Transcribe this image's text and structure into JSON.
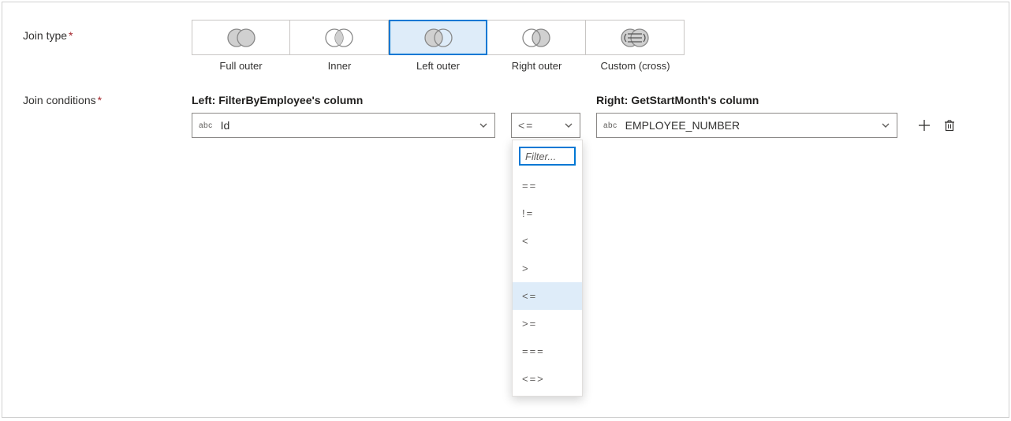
{
  "joinType": {
    "label": "Join type",
    "required": true,
    "options": [
      {
        "label": "Full outer",
        "kind": "full"
      },
      {
        "label": "Inner",
        "kind": "inner"
      },
      {
        "label": "Left outer",
        "kind": "left"
      },
      {
        "label": "Right outer",
        "kind": "right"
      },
      {
        "label": "Custom (cross)",
        "kind": "cross"
      }
    ],
    "selected": "Left outer"
  },
  "joinConditions": {
    "label": "Join conditions",
    "required": true,
    "leftHeader": "Left: FilterByEmployee's column",
    "rightHeader": "Right: GetStartMonth's column",
    "row": {
      "leftTypeChip": "abc",
      "leftValue": "Id",
      "operator": "<=",
      "rightTypeChip": "abc",
      "rightValue": "EMPLOYEE_NUMBER"
    }
  },
  "operatorDropdown": {
    "filterPlaceholder": "Filter...",
    "options": [
      "==",
      "!=",
      "<",
      ">",
      "<=",
      ">=",
      "===",
      "<=>"
    ],
    "selected": "<="
  }
}
